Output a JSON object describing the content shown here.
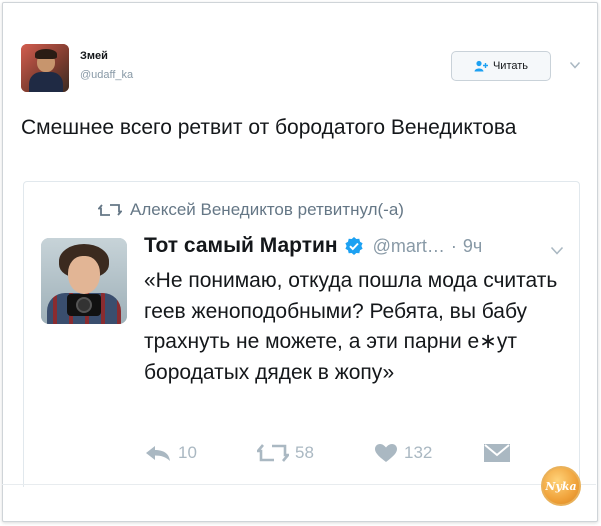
{
  "tweet": {
    "author_name": "Змей",
    "author_handle": "@udaff_ka",
    "follow_label": "Читать",
    "text": "Смешнее всего ретвит от бородатого Венедиктова"
  },
  "quoted": {
    "retweet_line": "Алексей Венедиктов ретвитнул(-а)",
    "author_name": "Тот самый Мартин",
    "author_handle": "@mart…",
    "separator": "·",
    "time": "9ч",
    "text": "«Не понимаю, откуда пошла мода считать геев женоподобными? Ребята, вы бабу трахнуть не можете, а эти парни е∗ут бородатых дядек в жопу»",
    "actions": {
      "replies": "10",
      "retweets": "58",
      "likes": "132"
    }
  },
  "watermark": "Nyka",
  "icons": [
    "follow-person-icon",
    "chevron-down-icon",
    "retweet-icon",
    "verified-icon",
    "reply-icon",
    "like-icon",
    "message-icon"
  ],
  "colors": {
    "muted": "#aab8c2",
    "secondary": "#657786",
    "verified": "#1da1f2",
    "text": "#14171a"
  }
}
